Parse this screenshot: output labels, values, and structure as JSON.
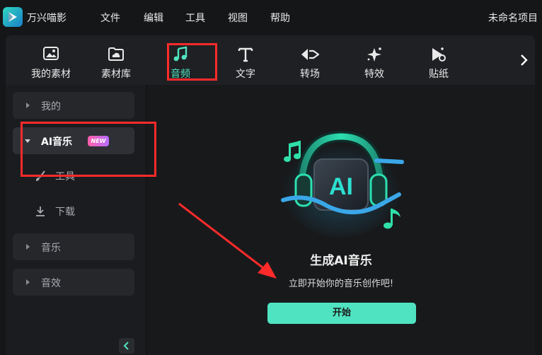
{
  "app": {
    "name": "万兴喵影",
    "project_name": "未命名项目"
  },
  "menu": [
    {
      "label": "文件"
    },
    {
      "label": "编辑"
    },
    {
      "label": "工具"
    },
    {
      "label": "视图"
    },
    {
      "label": "帮助"
    }
  ],
  "toolbar": {
    "tabs": [
      {
        "label": "我的素材",
        "icon": "image-icon"
      },
      {
        "label": "素材库",
        "icon": "cloud-folder-icon"
      },
      {
        "label": "音频",
        "icon": "music-note-icon",
        "active": true
      },
      {
        "label": "文字",
        "icon": "text-icon"
      },
      {
        "label": "转场",
        "icon": "transition-icon"
      },
      {
        "label": "特效",
        "icon": "sparkle-icon"
      },
      {
        "label": "贴纸",
        "icon": "sticker-icon"
      }
    ],
    "next_icon": "chevron-right-icon"
  },
  "sidebar": {
    "categories": [
      {
        "label": "我的",
        "expanded": false
      },
      {
        "label": "AI音乐",
        "expanded": true,
        "badge": "NEW"
      },
      {
        "label": "音乐",
        "expanded": false
      },
      {
        "label": "音效",
        "expanded": false
      }
    ],
    "ai_music_items": [
      {
        "label": "工具",
        "icon": "brush-icon"
      },
      {
        "label": "下载",
        "icon": "download-icon"
      }
    ],
    "collapse_icon": "chevron-left-icon"
  },
  "content": {
    "illustration": "ai-headphones-icon",
    "illustration_text": "AI",
    "title": "生成AI音乐",
    "subtitle": "立即开始你的音乐创作吧!",
    "start_label": "开始"
  },
  "colors": {
    "accent": "#4fe3c1",
    "annotation": "#ff2b2b",
    "badge_from": "#ff5fa8",
    "badge_to": "#b86cff"
  }
}
